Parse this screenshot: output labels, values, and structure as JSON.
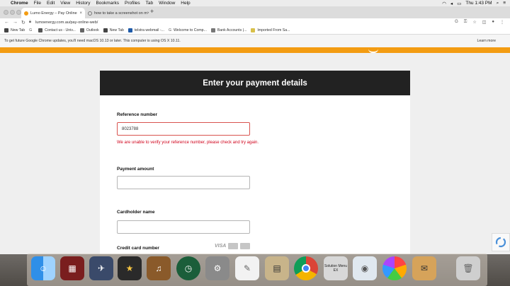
{
  "menubar": {
    "items": [
      "Chrome",
      "File",
      "Edit",
      "View",
      "History",
      "Bookmarks",
      "Profiles",
      "Tab",
      "Window",
      "Help"
    ],
    "clock": "Thu 1:43 PM"
  },
  "tabs": [
    {
      "title": "Lumo Energy – Pay Online",
      "close": "×"
    },
    {
      "title": "how to take a screenshot on m",
      "close": "×"
    }
  ],
  "new_tab": "+",
  "toolbar": {
    "url": "lumoenergy.com.au/pay-online-web/"
  },
  "bookmarks": [
    "New Tab",
    "Contact us - Univ...",
    "Outlook",
    "New Tab",
    "telstra webmail -...",
    "Welcome to Comp...",
    "Bank Accounts |...",
    "Imported From Sa..."
  ],
  "notice": {
    "text": "To get future Google Chrome updates, you'll need macOS 10.13 or later. This computer is using OS X 10.11.",
    "link": "Learn more"
  },
  "form": {
    "title": "Enter your payment details",
    "reference_label": "Reference number",
    "reference_value": "8023788",
    "reference_error": "We are unable to verify your reference number, please check and try again.",
    "amount_label": "Payment amount",
    "amount_value": "",
    "cardholder_label": "Cardholder name",
    "cardholder_value": "",
    "card_number_label": "Credit card number",
    "visa": "VISA"
  },
  "dock": {
    "solution_menu": "Solution Menu EX"
  },
  "colors": {
    "brand_orange": "#f39c12",
    "header_dark": "#222222",
    "error_red": "#d0021b"
  }
}
